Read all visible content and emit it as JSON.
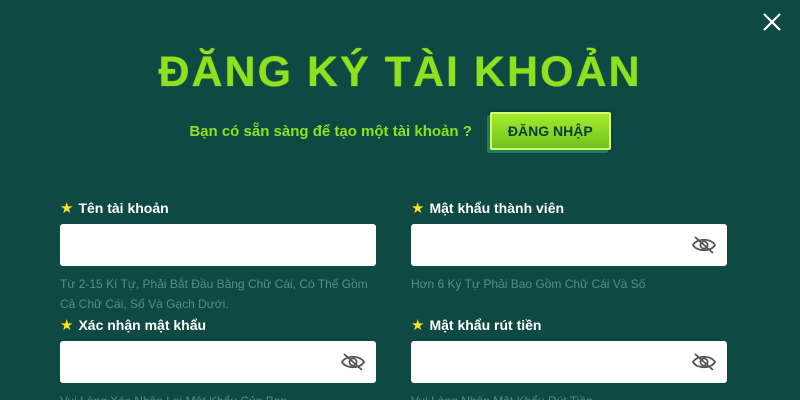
{
  "modal": {
    "title": "ĐĂNG KÝ TÀI KHOẢN",
    "subtitle": "Bạn có sẵn sàng để tạo một tài khoản ?",
    "login_label": "ĐĂNG NHẬP"
  },
  "fields": {
    "username": {
      "label": "Tên tài khoản",
      "value": "",
      "hint": "Từ 2-15 Kí Tự, Phải Bắt Đầu Bằng Chữ Cái, Có Thể Gồm Cả Chữ Cái, Số Và Gạch Dưới."
    },
    "password": {
      "label": "Mật khẩu thành viên",
      "value": "",
      "hint": "Hơn 6 Ký Tự Phải Bao Gồm Chữ Cái Và Số"
    },
    "confirm_password": {
      "label": "Xác nhận mật khẩu",
      "value": "",
      "hint": "Vui Lòng Xác Nhận Lại Mật Khẩu Của Bạn"
    },
    "withdraw_password": {
      "label": "Mật khẩu rút tiền",
      "value": "",
      "hint": "Vui Lòng Nhập Mật Khẩu Rút Tiền"
    }
  },
  "colors": {
    "background": "#0e4a43",
    "accent": "#8fe01e",
    "star": "#ffe11a"
  },
  "icons": {
    "close": "close-icon",
    "required": "star-icon",
    "toggle_visibility": "eye-off-icon"
  }
}
